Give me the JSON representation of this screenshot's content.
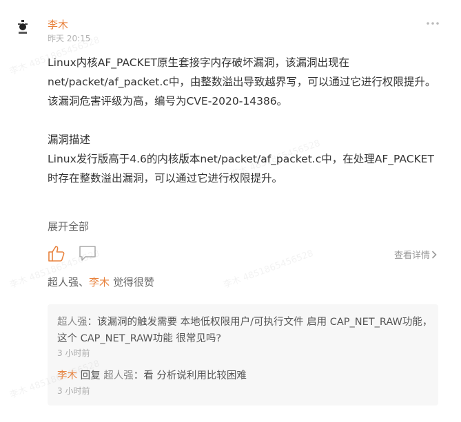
{
  "post": {
    "author": "李木",
    "time": "昨天 20:15",
    "paragraph1": "Linux内核AF_PACKET原生套接字内存破坏漏洞，该漏洞出现在net/packet/af_packet.c中，由整数溢出导致越界写，可以通过它进行权限提升。该漏洞危害评级为高，编号为CVE-2020-14386。",
    "heading": "漏洞描述",
    "paragraph2": "Linux发行版高于4.6的内核版本net/packet/af_packet.c中，在处理AF_PACKET时存在整数溢出漏洞，可以通过它进行权限提升。",
    "expand_label": "展开全部",
    "detail_label": "查看详情"
  },
  "likes": {
    "name1": "超人强",
    "separator": "、",
    "name2": "李木",
    "suffix": " 觉得很赞"
  },
  "comments": [
    {
      "author": "超人强",
      "colon": "：",
      "text": "该漏洞的触发需要 本地低权限用户/可执行文件 启用 CAP_NET_RAW功能，这个 CAP_NET_RAW功能 很常见吗?",
      "time": "3 小时前"
    },
    {
      "author": "李木",
      "reply_word": " 回复 ",
      "reply_to": "超人强",
      "colon": "：",
      "text": "看 分析说利用比较困难",
      "time": "3 小时前"
    }
  ],
  "watermark": "李木 4851865456528",
  "colors": {
    "accent": "#e8823d",
    "comment_bg": "#f7f7f7"
  }
}
